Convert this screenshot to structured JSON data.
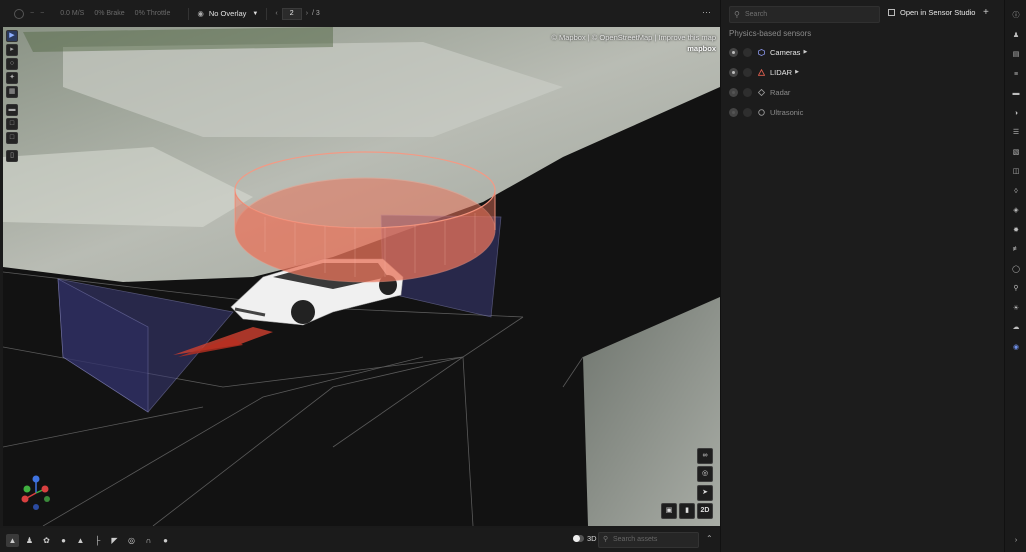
{
  "topbar": {
    "speed": "0.0 M/S",
    "brake": "0% Brake",
    "throttle": "0% Throttle",
    "overlay": "No Overlay",
    "page_current": "2",
    "page_total": "/ 3",
    "more": "⋯"
  },
  "viewport": {
    "attribution": "© Mapbox | © OpenStreetMap | Improve this map",
    "mapbox_logo": "mapbox",
    "btn_2d": "2D",
    "colors": {
      "lidar_ring": "#e8735a",
      "camera_frustum": "#3a3a78",
      "ground": "#141414"
    }
  },
  "bottombar": {
    "toggle_label": "3D",
    "search_placeholder": "Search assets"
  },
  "panel": {
    "search_placeholder": "Search",
    "open_studio": "Open in Sensor Studio",
    "add": "+",
    "section_title": "Physics-based sensors",
    "sensors": [
      {
        "label": "Cameras",
        "visible": true,
        "shape_color": "#7f8ad6"
      },
      {
        "label": "LIDAR",
        "visible": true,
        "shape_color": "#e06050"
      },
      {
        "label": "Radar",
        "visible": false,
        "shape_color": "#9a9a9a"
      },
      {
        "label": "Ultrasonic",
        "visible": false,
        "shape_color": "#9a9a9a"
      }
    ]
  }
}
